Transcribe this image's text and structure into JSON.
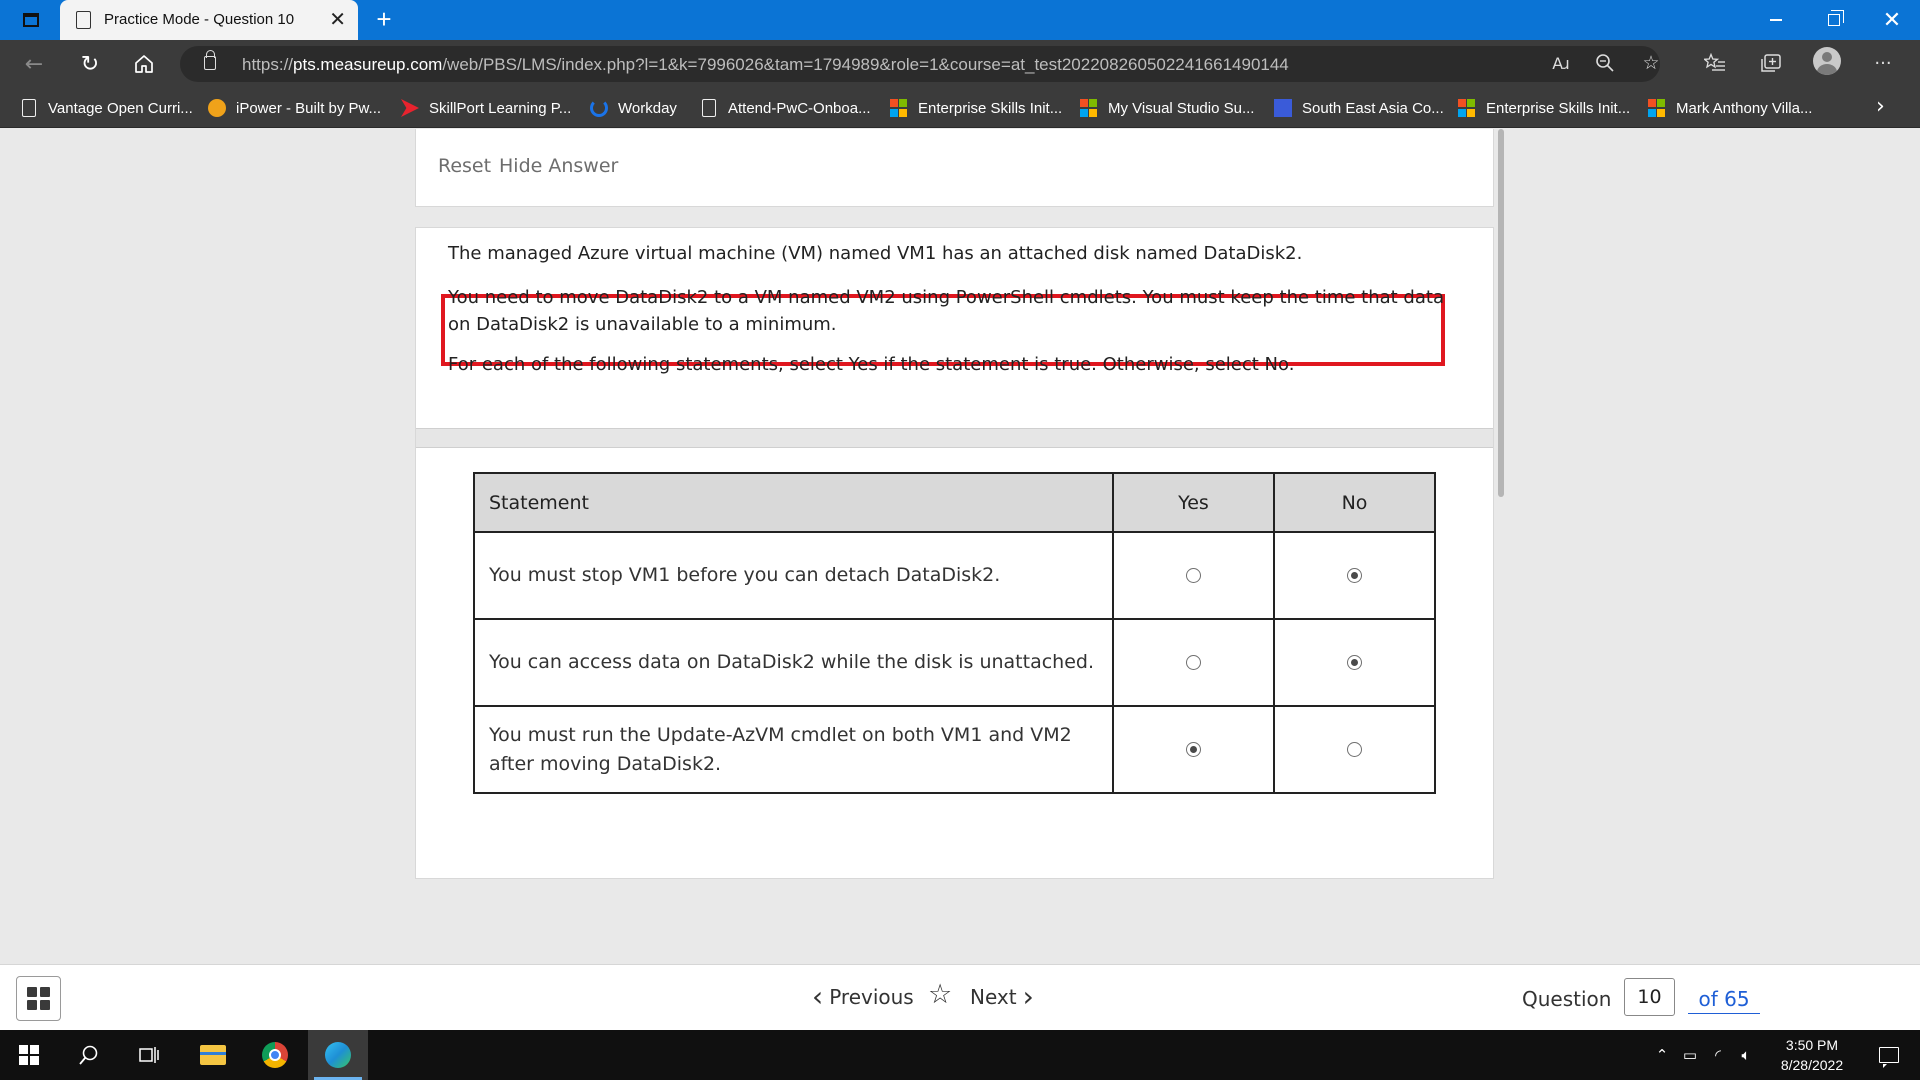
{
  "browser": {
    "tab_title": "Practice Mode - Question 10",
    "tab_close": "✕",
    "new_tab": "+",
    "url_prefix": "https://",
    "url_host": "pts.measureup.com",
    "url_path": "/web/PBS/LMS/index.php?l=1&k=7996026&tam=1794989&role=1&course=at_test20220826050224166149014​4",
    "read_aloud": "Aɹ",
    "more": "···",
    "favorites": [
      {
        "label": "Vantage Open Curri...",
        "icon": "page-icon"
      },
      {
        "label": "iPower - Built by Pw...",
        "icon": "ipower-icon"
      },
      {
        "label": "SkillPort Learning P...",
        "icon": "skillport-icon"
      },
      {
        "label": "Workday",
        "icon": "workday-icon"
      },
      {
        "label": "Attend-PwC-Onboa...",
        "icon": "page-icon"
      },
      {
        "label": "Enterprise Skills Init...",
        "icon": "microsoft-icon"
      },
      {
        "label": "My Visual Studio Su...",
        "icon": "microsoft-icon"
      },
      {
        "label": "South East Asia Co...",
        "icon": "sea-icon"
      },
      {
        "label": "Enterprise Skills Init...",
        "icon": "microsoft-icon"
      },
      {
        "label": "Mark Anthony Villa...",
        "icon": "microsoft-icon"
      }
    ]
  },
  "controls": {
    "reset": "Reset",
    "hide_answer": "Hide Answer"
  },
  "question": {
    "p1": "The managed Azure virtual machine (VM) named VM1 has an attached disk named DataDisk2.",
    "p2": "You need to move DataDisk2 to a VM named VM2 using PowerShell cmdlets. You must keep the time that data on DataDisk2 is unavailable to a minimum.",
    "p3": "For each of the following statements, select Yes if the statement is true. Otherwise, select No.",
    "highlight_color": "#e0171f"
  },
  "table": {
    "headers": {
      "statement": "Statement",
      "yes": "Yes",
      "no": "No"
    },
    "rows": [
      {
        "statement": "You must stop VM1 before you can detach DataDisk2.",
        "selected": "no"
      },
      {
        "statement": "You can access data on DataDisk2 while the disk is unattached.",
        "selected": "no"
      },
      {
        "statement": "You must run the Update-AzVM cmdlet on both VM1 and VM2 after moving DataDisk2.",
        "selected": "yes"
      }
    ]
  },
  "bottom": {
    "previous": "Previous",
    "next": "Next",
    "question_label": "Question",
    "question_number": "10",
    "of_total": "of 65"
  },
  "taskbar": {
    "time": "3:50 PM",
    "date": "8/28/2022"
  },
  "colors": {
    "titlebar": "#0b74d5",
    "toolbar": "#3b3b3b",
    "link_blue": "#1f5fd6"
  }
}
